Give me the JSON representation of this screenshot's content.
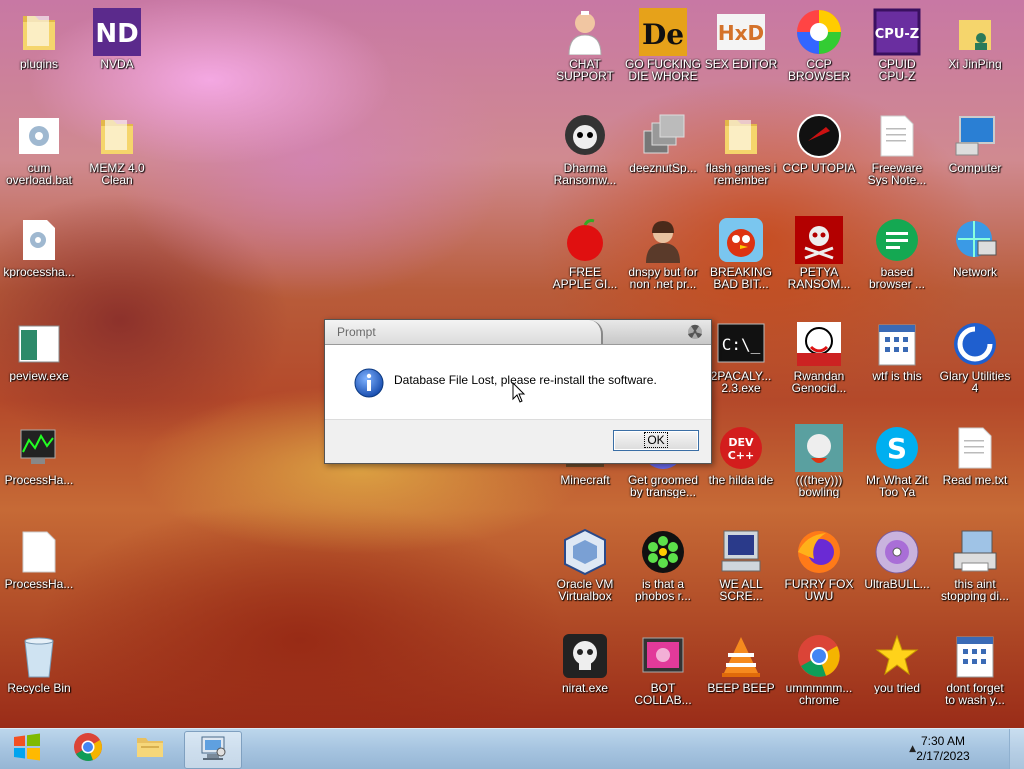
{
  "desktop": {
    "icons_left": [
      {
        "label": "plugins",
        "icon": "folder-icon"
      },
      {
        "label": "NVDA",
        "icon": "nvda-icon"
      },
      {
        "label": "cum\noverload.bat",
        "icon": "batch-file-icon"
      },
      {
        "label": "MEMZ 4.0\nClean",
        "icon": "folder-icon"
      },
      {
        "label": "kprocessha...",
        "icon": "settings-file-icon"
      },
      {
        "label": "peview.exe",
        "icon": "peview-icon"
      },
      {
        "label": "ProcessHa...",
        "icon": "process-monitor-icon"
      },
      {
        "label": "ProcessHa...",
        "icon": "blank-file-icon"
      },
      {
        "label": "Recycle Bin",
        "icon": "recycle-bin-icon"
      }
    ],
    "icons_right": [
      {
        "label": "CHAT\nSUPPORT",
        "icon": "doctor-icon"
      },
      {
        "label": "GO FUCKING\nDIE WHORE",
        "icon": "die-icon"
      },
      {
        "label": "SEX EDITOR",
        "icon": "hxd-icon"
      },
      {
        "label": "CCP\nBROWSER",
        "icon": "browser-icon"
      },
      {
        "label": "CPUID\nCPU-Z",
        "icon": "cpuz-icon"
      },
      {
        "label": "Xi JinPing",
        "icon": "user-folder-icon"
      },
      {
        "label": "Dharma\nRansomw...",
        "icon": "skull-helmet-icon"
      },
      {
        "label": "deeznutSp...",
        "icon": "stacked-windows-icon"
      },
      {
        "label": "flash games i\nremember",
        "icon": "folder-icon"
      },
      {
        "label": "CCP UTOPIA",
        "icon": "red-circle-icon"
      },
      {
        "label": "Freeware\nSys Note...",
        "icon": "text-file-icon"
      },
      {
        "label": "Computer",
        "icon": "computer-icon"
      },
      {
        "label": "FREE\nAPPLE GI...",
        "icon": "apple-icon"
      },
      {
        "label": "dnspy but for\nnon .net pr...",
        "icon": "portrait-icon"
      },
      {
        "label": "BREAKING\nBAD BIT...",
        "icon": "angry-bird-icon"
      },
      {
        "label": "PETYA\nRANSOM...",
        "icon": "red-skull-icon"
      },
      {
        "label": "based\nbrowser ...",
        "icon": "green-doc-icon"
      },
      {
        "label": "Network",
        "icon": "network-icon"
      },
      {
        "label": "2PACALY...\n2.3.exe",
        "icon": "terminal-icon"
      },
      {
        "label": "Rwandan\nGenocid...",
        "icon": "meme-face-icon"
      },
      {
        "label": "wtf is this",
        "icon": "calendar-icon"
      },
      {
        "label": "Glary Utilities\n4",
        "icon": "glary-icon"
      },
      {
        "label": "Minecraft",
        "icon": "minecraft-icon"
      },
      {
        "label": "Get groomed\nby transge...",
        "icon": "groomed-icon"
      },
      {
        "label": "the hilda ide",
        "icon": "devcpp-icon"
      },
      {
        "label": "(((they)))\nbowling",
        "icon": "bowling-icon"
      },
      {
        "label": "Mr What Zit\nToo Ya",
        "icon": "skype-icon"
      },
      {
        "label": "Read me.txt",
        "icon": "text-file-icon"
      },
      {
        "label": "Oracle VM\nVirtualbox",
        "icon": "virtualbox-icon"
      },
      {
        "label": "is that a\nphobos r...",
        "icon": "icq-icon"
      },
      {
        "label": "WE ALL\nSCRE...",
        "icon": "old-computer-icon"
      },
      {
        "label": "FURRY FOX\nUWU",
        "icon": "firefox-icon"
      },
      {
        "label": "UltraBULL...",
        "icon": "disc-icon"
      },
      {
        "label": "this aint\nstopping di...",
        "icon": "computer-printer-icon"
      },
      {
        "label": "nirat.exe",
        "icon": "skull-icon"
      },
      {
        "label": "BOT\nCOLLAB...",
        "icon": "media-icon"
      },
      {
        "label": "BEEP BEEP",
        "icon": "vlc-icon"
      },
      {
        "label": "ummmmm...\nchrome",
        "icon": "chrome-icon"
      },
      {
        "label": "you tried",
        "icon": "star-icon"
      },
      {
        "label": "dont forget\nto wash y...",
        "icon": "calendar-icon"
      }
    ]
  },
  "dialog": {
    "title": "Prompt",
    "message": "Database File Lost, please re-install the software.",
    "ok_label": "OK"
  },
  "taskbar": {
    "start": "start-orb-icon",
    "pinned": [
      "chrome-icon",
      "file-explorer-icon",
      "control-panel-icon"
    ],
    "time": "7:30 AM",
    "date": "2/17/2023"
  }
}
